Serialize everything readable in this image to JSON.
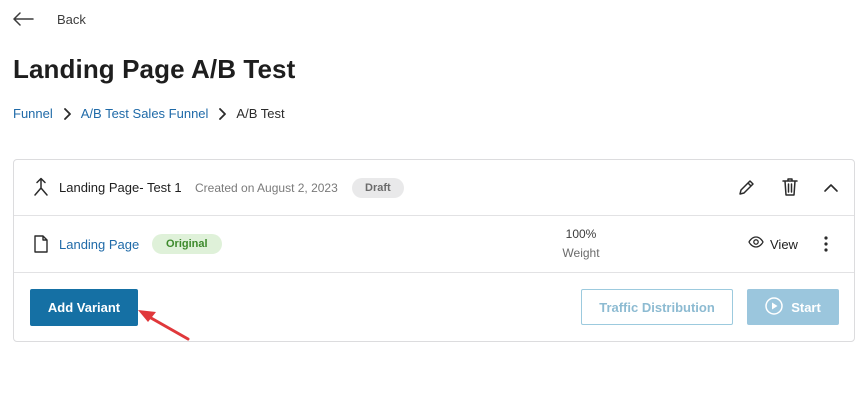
{
  "nav": {
    "back_label": "Back"
  },
  "page": {
    "title": "Landing Page A/B Test"
  },
  "breadcrumb": {
    "items": [
      "Funnel",
      "A/B Test Sales Funnel",
      "A/B Test"
    ]
  },
  "test": {
    "name": "Landing Page- Test 1",
    "created": "Created on August 2, 2023",
    "status": "Draft"
  },
  "variant": {
    "name": "Landing Page",
    "badge": "Original",
    "weight_value": "100%",
    "weight_label": "Weight",
    "view_label": "View"
  },
  "actions": {
    "add_variant": "Add Variant",
    "traffic_distribution": "Traffic Distribution",
    "start": "Start"
  },
  "colors": {
    "primary": "#1570a4",
    "link": "#1f6aa8",
    "annotation_arrow": "#e0383b",
    "original_badge_bg": "#dff1d9",
    "draft_badge_bg": "#e9e9ea"
  },
  "icons": [
    "back-arrow-icon",
    "chevron-right-icon",
    "split-test-icon",
    "pencil-icon",
    "trash-icon",
    "chevron-up-icon",
    "document-icon",
    "eye-icon",
    "more-vertical-icon",
    "play-circle-icon"
  ]
}
